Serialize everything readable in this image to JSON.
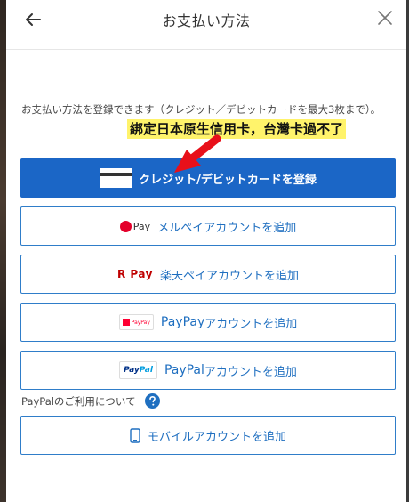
{
  "header": {
    "title": "お支払い方法"
  },
  "description": "お支払い方法を登録できます（クレジット／デビットカードを最大3枚まで）。",
  "annotation": "綁定日本原生信用卡，台灣卡過不了",
  "buttons": {
    "credit": {
      "label": "クレジット/デビットカードを登録"
    },
    "merpay": {
      "logo_text": "Pay",
      "label": "メルペイアカウントを追加"
    },
    "rakuten": {
      "logo_text": "R Pay",
      "label": "楽天ペイアカウントを追加"
    },
    "paypay": {
      "logo_text": "PayPay",
      "label_brand": "PayPay",
      "label": "アカウントを追加"
    },
    "paypal": {
      "logo_text_1": "Pay",
      "logo_text_2": "Pal",
      "label_brand": "PayPal",
      "label": "アカウントを追加"
    },
    "mobile": {
      "label": "モバイルアカウントを追加"
    }
  },
  "paypal_about": "PayPalのご利用について",
  "colors": {
    "primary": "#1b66c6",
    "outline": "#2f7dc9",
    "annotation_bg": "#fff36b",
    "arrow": "#e8101a"
  },
  "icons": [
    "back-arrow-icon",
    "close-icon",
    "credit-card-icon",
    "merpay-icon",
    "rakuten-pay-icon",
    "paypay-icon",
    "paypal-icon",
    "help-icon",
    "mobile-phone-icon"
  ]
}
